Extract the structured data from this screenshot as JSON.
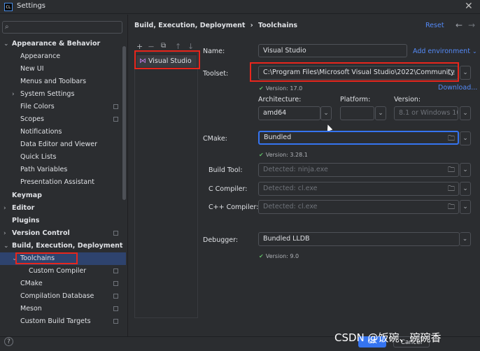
{
  "window": {
    "title": "Settings",
    "app_icon": "CL"
  },
  "search": {
    "placeholder": ""
  },
  "sidebar": {
    "items": [
      {
        "label": "Appearance & Behavior"
      },
      {
        "label": "Appearance"
      },
      {
        "label": "New UI"
      },
      {
        "label": "Menus and Toolbars"
      },
      {
        "label": "System Settings"
      },
      {
        "label": "File Colors"
      },
      {
        "label": "Scopes"
      },
      {
        "label": "Notifications"
      },
      {
        "label": "Data Editor and Viewer"
      },
      {
        "label": "Quick Lists"
      },
      {
        "label": "Path Variables"
      },
      {
        "label": "Presentation Assistant"
      },
      {
        "label": "Keymap"
      },
      {
        "label": "Editor"
      },
      {
        "label": "Plugins"
      },
      {
        "label": "Version Control"
      },
      {
        "label": "Build, Execution, Deployment"
      },
      {
        "label": "Toolchains"
      },
      {
        "label": "Custom Compiler"
      },
      {
        "label": "CMake"
      },
      {
        "label": "Compilation Database"
      },
      {
        "label": "Meson"
      },
      {
        "label": "Custom Build Targets"
      }
    ]
  },
  "header": {
    "breadcrumb_parent": "Build, Execution, Deployment",
    "breadcrumb_sep": "›",
    "breadcrumb_current": "Toolchains",
    "reset": "Reset"
  },
  "toolchains": {
    "toolbar": {
      "add": "+",
      "remove": "—",
      "copy": "⧉",
      "up": "↑",
      "down": "↓"
    },
    "items": [
      {
        "label": "Visual Studio"
      }
    ]
  },
  "form": {
    "name_label": "Name:",
    "name_value": "Visual Studio",
    "add_environment": "Add environment",
    "toolset_label": "Toolset:",
    "toolset_value": "C:\\Program Files\\Microsoft Visual Studio\\2022\\Community",
    "toolset_version": "Version: 17.0",
    "download": "Download...",
    "architecture_label": "Architecture:",
    "architecture_value": "amd64",
    "platform_label": "Platform:",
    "platform_value": "",
    "version_label": "Version:",
    "version_value": "8.1 or Windows 10",
    "cmake_label": "CMake:",
    "cmake_value": "Bundled",
    "cmake_version": "Version: 3.28.1",
    "build_tool_label": "Build Tool:",
    "build_tool_placeholder": "Detected: ninja.exe",
    "c_compiler_label": "C Compiler:",
    "c_compiler_placeholder": "Detected: cl.exe",
    "cpp_compiler_label": "C++ Compiler:",
    "cpp_compiler_placeholder": "Detected: cl.exe",
    "debugger_label": "Debugger:",
    "debugger_value": "Bundled LLDB",
    "debugger_version": "Version: 9.0"
  },
  "footer": {
    "help": "?",
    "ok": "OK",
    "cancel": "Cancel"
  },
  "watermark": "CSDN @饭碗、碗碗香",
  "colors": {
    "accent": "#3574f0",
    "highlight_box": "#e8261c",
    "ok_check": "#5fb865",
    "selection": "#2e436e"
  }
}
